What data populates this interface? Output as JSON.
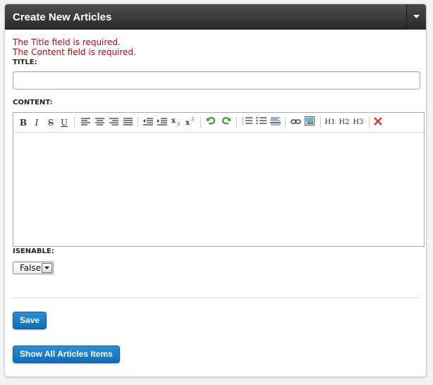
{
  "panel": {
    "title": "Create New Articles"
  },
  "errors": [
    "The Title field is required.",
    "The Content field is required."
  ],
  "title_field": {
    "label": "TITLE:",
    "value": ""
  },
  "content_field": {
    "label": "CONTENT:"
  },
  "toolbar": {
    "bold": "B",
    "italic": "I",
    "strike": "S",
    "underline": "U",
    "h1": "H1",
    "h2": "H2",
    "h3": "H3"
  },
  "isenable_field": {
    "label": "ISENABLE:",
    "selected": "False"
  },
  "buttons": {
    "save": "Save",
    "show_all": "Show All Articles Items"
  },
  "colors": {
    "header": "#333333",
    "error": "#cc0000",
    "button": "#1a7cc8"
  }
}
